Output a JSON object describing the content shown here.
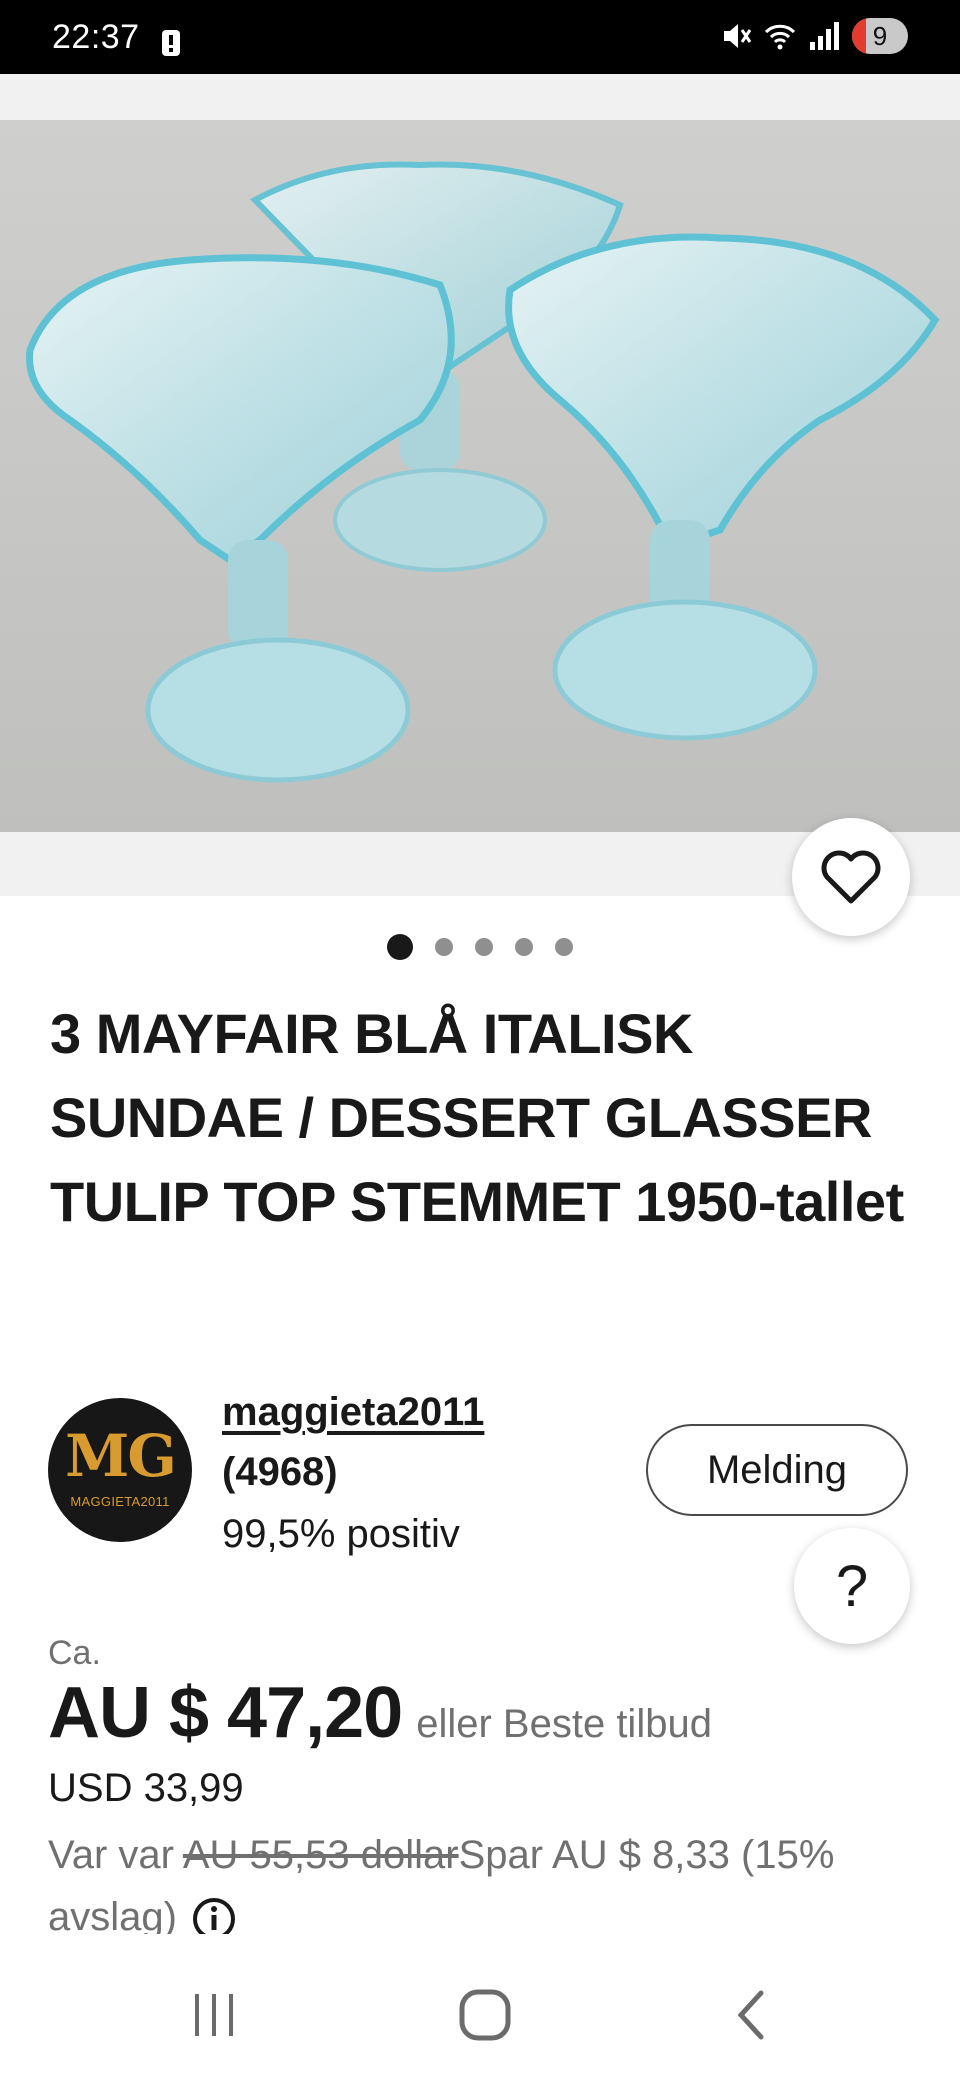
{
  "status_bar": {
    "time": "22:37",
    "battery": "9",
    "icons": [
      "alert-icon",
      "mute-icon",
      "wifi-icon",
      "signal-icon",
      "battery-icon"
    ]
  },
  "gallery": {
    "image_count": 5,
    "active_index": 0,
    "favorite_icon": "heart-outline-icon"
  },
  "listing": {
    "title": "3 MAYFAIR BLÅ ITALISK SUNDAE / DESSERT GLASSER TULIP TOP STEMMET 1950-tallet"
  },
  "seller": {
    "logo_text": "MG",
    "logo_subtext": "MAGGIETA2011",
    "name": "maggieta2011",
    "feedback_count": "(4968)",
    "positive": "99,5% positiv",
    "message_label": "Melding",
    "help_label": "?"
  },
  "price": {
    "approx_label": "Ca.",
    "amount": "AU $ 47,20",
    "best_offer": "eller Beste tilbud",
    "usd": "USD 33,99",
    "was_prefix": "Var var ",
    "was_amount": "AU 55,53 dollar",
    "savings": "Spar AU $ 8,33 (15% avslag)"
  },
  "colors": {
    "text": "#191919",
    "secondary": "#707070",
    "logo_gold": "#d89b2f",
    "battery_low": "#e33b2e"
  },
  "nav_bar": {
    "buttons": [
      "recent-apps-icon",
      "home-icon",
      "back-icon"
    ]
  }
}
